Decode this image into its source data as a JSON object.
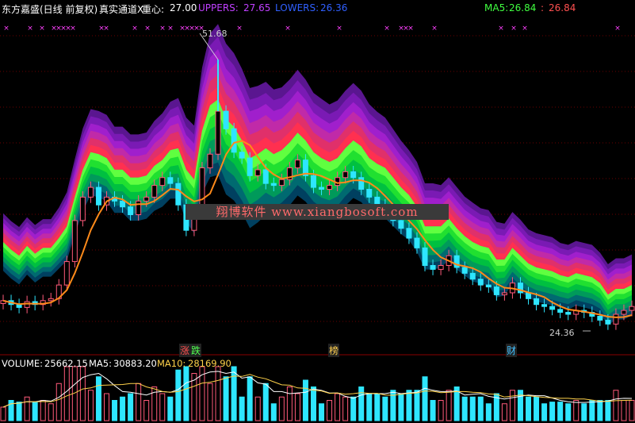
{
  "header": {
    "name_label": "东方嘉盛(日线 前复权)",
    "indicator_name": "真实通道X",
    "center_label": "重心:",
    "center_value": "27.00",
    "upper_label": "UPPERS:",
    "upper_value": "27.65",
    "lower_label": "LOWERS:",
    "lower_value": "26.36",
    "ma5_label": "MA5:",
    "ma5_value": "26.84",
    "ma5_value2": "26.84"
  },
  "volume_header": {
    "volume_label": "VOLUME:",
    "volume_value": "25662.15",
    "ma5_label": "MA5:",
    "ma5_value": "30883.20",
    "ma10_label": "MA10:",
    "ma10_value": "28169.90"
  },
  "annotations": {
    "high_label": "51.68",
    "low_label": "24.36"
  },
  "events": [
    {
      "label": "涨",
      "color": "#ff5050"
    },
    {
      "label": "跌",
      "color": "#50ff50"
    },
    {
      "label": "榜",
      "color": "#ffd050"
    },
    {
      "label": "财",
      "color": "#40c0ff"
    }
  ],
  "watermark": "翔博软件 www.xiangbosoft.com",
  "colors": {
    "up": "#ff5a7a",
    "down": "#2ee6ff",
    "ma5_line": "#ff8a1a",
    "volume_ma5": "#ffffff",
    "volume_ma10": "#ffd24a",
    "header_center": "#ffffff",
    "header_upper": "#c040ff",
    "header_lower": "#3060ff",
    "header_ma5": "#40ff40"
  },
  "chart_data": {
    "type": "candlestick",
    "ylim": [
      23,
      56
    ],
    "price_high": 51.68,
    "price_low": 24.36,
    "center": [
      33.0,
      32.2,
      31.6,
      32.6,
      31.8,
      32.4,
      32.4,
      33.4,
      34.6,
      37.6,
      40.4,
      42.2,
      42.0,
      41.6,
      40.4,
      40.4,
      39.6,
      39.6,
      39.8,
      40.8,
      41.4,
      42.4,
      42.6,
      40.4,
      39.4,
      44.4,
      47.0,
      47.6,
      45.6,
      44.8,
      43.4,
      41.6,
      42.0,
      42.6,
      42.0,
      42.4,
      43.2,
      44.2,
      43.4,
      42.2,
      41.6,
      41.2,
      41.6,
      42.6,
      43.4,
      42.8,
      41.6,
      41.0,
      40.6,
      39.6,
      38.6,
      37.8,
      36.6,
      34.6,
      34.6,
      34.6,
      35.4,
      34.4,
      33.6,
      33.0,
      32.6,
      32.4,
      31.2,
      31.2,
      32.4,
      31.6,
      30.8,
      30.4,
      30.2,
      30.0,
      29.6,
      29.4,
      29.8,
      29.6,
      29.4,
      28.8,
      27.6,
      28.2,
      28.2,
      28.6
    ],
    "band_half_width": [
      1.6,
      1.6,
      1.6,
      1.6,
      1.6,
      1.6,
      1.6,
      1.7,
      1.9,
      2.1,
      2.3,
      2.4,
      2.4,
      2.4,
      2.4,
      2.4,
      2.4,
      2.4,
      2.4,
      2.5,
      2.6,
      2.7,
      2.8,
      2.9,
      3.0,
      3.5,
      4.0,
      4.2,
      4.2,
      4.1,
      4.0,
      3.9,
      3.8,
      3.7,
      3.6,
      3.5,
      3.5,
      3.5,
      3.4,
      3.3,
      3.3,
      3.2,
      3.2,
      3.2,
      3.2,
      3.1,
      3.0,
      2.9,
      2.8,
      2.7,
      2.6,
      2.5,
      2.5,
      2.4,
      2.4,
      2.3,
      2.3,
      2.3,
      2.2,
      2.2,
      2.1,
      2.1,
      2.1,
      2.0,
      2.0,
      2.0,
      1.9,
      1.9,
      1.9,
      1.9,
      1.8,
      1.8,
      1.8,
      1.8,
      1.8,
      1.7,
      1.7,
      1.7,
      1.7,
      1.7
    ],
    "close": [
      27.0,
      26.6,
      26.3,
      26.9,
      26.6,
      27.0,
      27.2,
      28.6,
      31.0,
      35.2,
      37.6,
      38.6,
      36.8,
      37.6,
      37.2,
      36.6,
      35.8,
      37.2,
      37.6,
      38.8,
      39.6,
      39.0,
      36.8,
      34.2,
      36.2,
      40.6,
      42.0,
      46.4,
      44.6,
      42.2,
      41.6,
      39.8,
      40.4,
      39.0,
      38.8,
      39.4,
      40.6,
      41.4,
      39.8,
      38.6,
      38.4,
      38.8,
      39.6,
      40.2,
      39.6,
      38.4,
      37.6,
      36.8,
      36.2,
      35.2,
      34.4,
      33.4,
      32.4,
      30.6,
      30.2,
      30.6,
      31.6,
      30.4,
      29.8,
      29.2,
      28.6,
      28.4,
      27.6,
      27.8,
      28.8,
      27.8,
      27.2,
      26.6,
      26.4,
      26.1,
      25.8,
      25.6,
      26.0,
      25.8,
      25.4,
      25.0,
      24.6,
      25.6,
      26.0,
      26.4
    ]
  }
}
